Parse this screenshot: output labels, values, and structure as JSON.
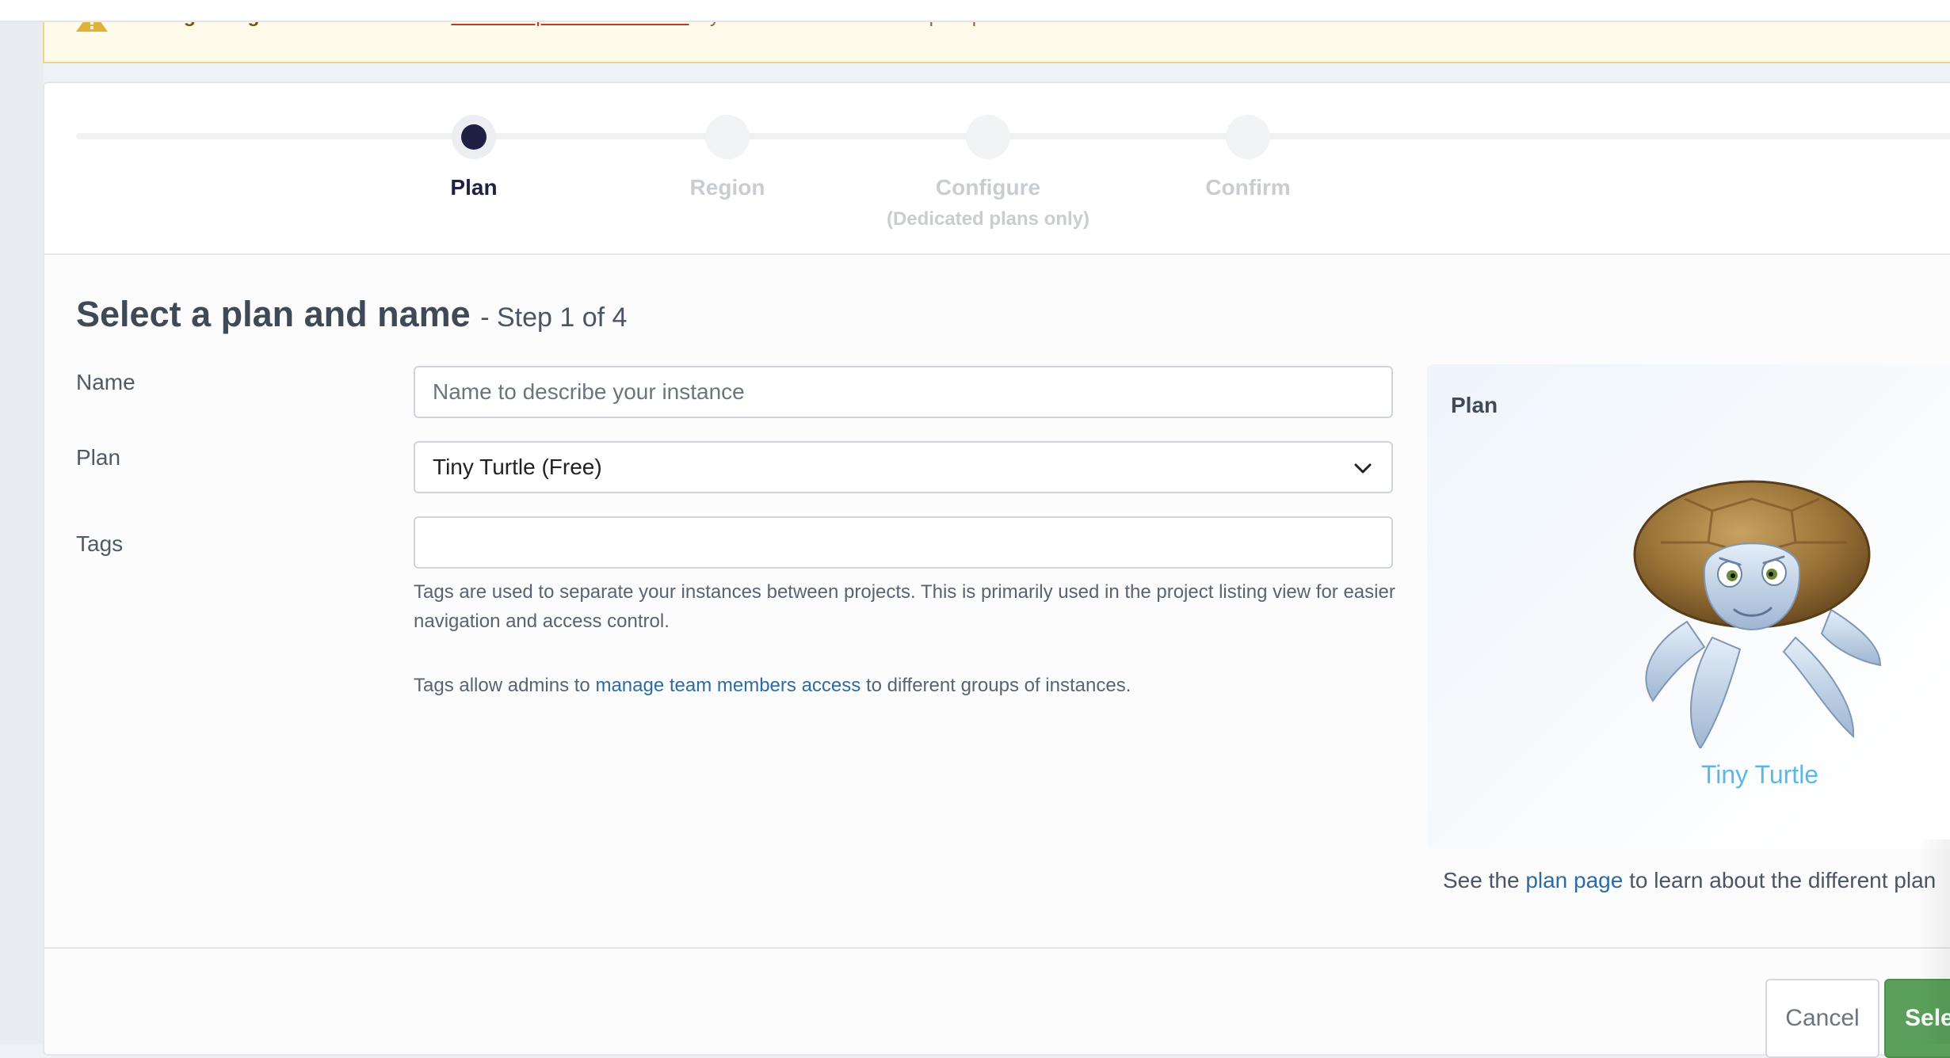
{
  "banner": {
    "title": "Missing billing information.",
    "pre_link": "Please",
    "link": "Enter Required Information",
    "post_link": "if you want to subscribe to paid plans."
  },
  "steps": [
    {
      "label": "Plan",
      "sub": "",
      "active": true
    },
    {
      "label": "Region",
      "sub": "",
      "active": false
    },
    {
      "label": "Configure",
      "sub": "(Dedicated plans only)",
      "active": false
    },
    {
      "label": "Confirm",
      "sub": "",
      "active": false
    }
  ],
  "form": {
    "heading": "Select a plan and name",
    "step_text": "- Step 1 of 4",
    "name_label": "Name",
    "name_placeholder": "Name to describe your instance",
    "plan_label": "Plan",
    "plan_selected": "Tiny Turtle (Free)",
    "tags_label": "Tags",
    "tags_value": "",
    "tags_help": "Tags are used to separate your instances between projects. This is primarily used in the project listing view for easier navigation and access control.",
    "tags_admin_pre": "Tags allow admins to",
    "tags_admin_link": "manage team members access",
    "tags_admin_post": "to different groups of instances."
  },
  "plan_panel": {
    "title": "Plan",
    "plan_name": "Tiny Turtle",
    "image_icon": "turtle-mascot",
    "note_pre": "See the",
    "note_link": "plan page",
    "note_post": "to learn about the different plan"
  },
  "footer": {
    "cancel_label": "Cancel",
    "select_label": "Selec"
  },
  "colors": {
    "active_step": "#1f2043",
    "link": "#2d6ca2",
    "plan_name": "#5bb8e6",
    "select_button": "#5aa05a",
    "warning_bg": "#fffbea"
  }
}
